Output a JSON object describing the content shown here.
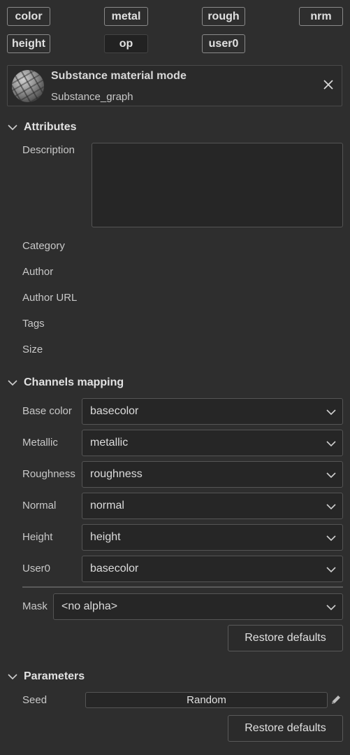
{
  "channel_chips": {
    "color": "color",
    "metal": "metal",
    "rough": "rough",
    "nrm": "nrm",
    "height": "height",
    "op": "op",
    "user0": "user0"
  },
  "material_card": {
    "title": "Substance material mode",
    "subtitle": "Substance_graph",
    "thumbnail_icon": "material-sphere-icon",
    "close_icon": "close-icon"
  },
  "attributes": {
    "header": "Attributes",
    "description_label": "Description",
    "description_value": "",
    "category_label": "Category",
    "author_label": "Author",
    "author_url_label": "Author URL",
    "tags_label": "Tags",
    "size_label": "Size"
  },
  "channels_mapping": {
    "header": "Channels mapping",
    "rows": [
      {
        "label": "Base color",
        "value": "basecolor"
      },
      {
        "label": "Metallic",
        "value": "metallic"
      },
      {
        "label": "Roughness",
        "value": "roughness"
      },
      {
        "label": "Normal",
        "value": "normal"
      },
      {
        "label": "Height",
        "value": "height"
      },
      {
        "label": "User0",
        "value": "basecolor"
      }
    ],
    "mask_label": "Mask",
    "mask_value": "<no alpha>",
    "restore_label": "Restore defaults"
  },
  "parameters": {
    "header": "Parameters",
    "seed_label": "Seed",
    "seed_value": "Random",
    "restore_label": "Restore defaults"
  },
  "colors": {
    "background": "#2e2e2e",
    "field_background": "#262626",
    "border": "#555555",
    "text": "#c8c8c8"
  }
}
